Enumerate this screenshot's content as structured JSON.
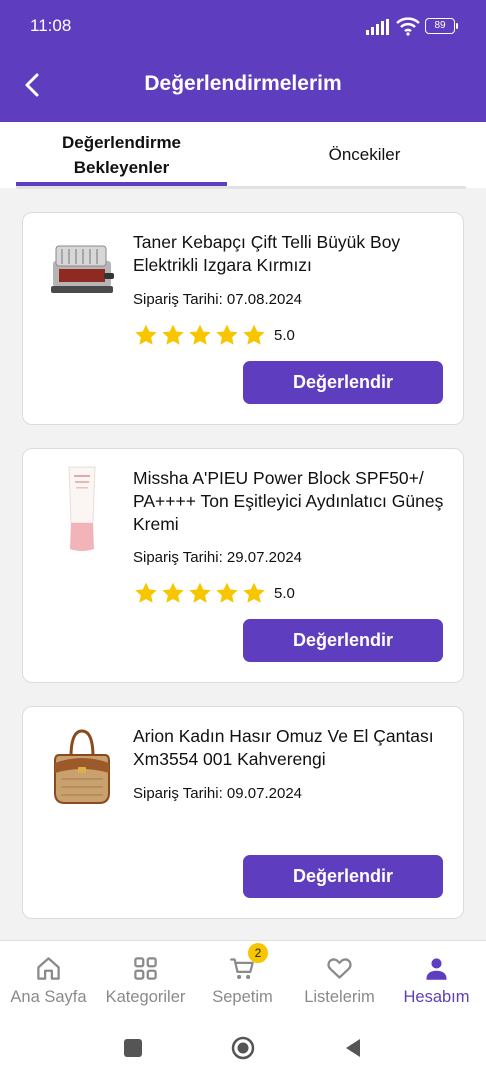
{
  "status_bar": {
    "time": "11:08",
    "battery": "89"
  },
  "header": {
    "title": "Değerlendirmelerim"
  },
  "tabs": [
    {
      "label": "Değerlendirme Bekleyenler",
      "active": true
    },
    {
      "label": "Öncekiler",
      "active": false
    }
  ],
  "orders": [
    {
      "title": "Taner Kebapçı Çift Telli Büyük Boy Elektrikli Izgara Kırmızı",
      "date": "Sipariş Tarihi: 07.08.2024",
      "rating": "5.0",
      "rating_stars": 5,
      "button": "Değerlendir",
      "image": "electric-grill"
    },
    {
      "title": "Missha A'PIEU Power Block SPF50+/ PA++++ Ton Eşitleyici Aydınlatıcı Güneş Kremi",
      "date": "Sipariş Tarihi: 29.07.2024",
      "rating": "5.0",
      "rating_stars": 5,
      "button": "Değerlendir",
      "image": "sunscreen-tube"
    },
    {
      "title": "Arion Kadın Hasır Omuz Ve El Çantası Xm3554 001 Kahverengi",
      "date": "Sipariş Tarihi: 09.07.2024",
      "button": "Değerlendir",
      "image": "straw-bag"
    }
  ],
  "bottom_nav": [
    {
      "label": "Ana Sayfa",
      "icon": "home-icon"
    },
    {
      "label": "Kategoriler",
      "icon": "grid-icon"
    },
    {
      "label": "Sepetim",
      "icon": "cart-icon",
      "badge": "2"
    },
    {
      "label": "Listelerim",
      "icon": "heart-icon"
    },
    {
      "label": "Hesabım",
      "icon": "person-icon",
      "active": true
    }
  ],
  "colors": {
    "primary": "#5e3ebe",
    "star": "#f7c600",
    "badge": "#f7c600"
  }
}
